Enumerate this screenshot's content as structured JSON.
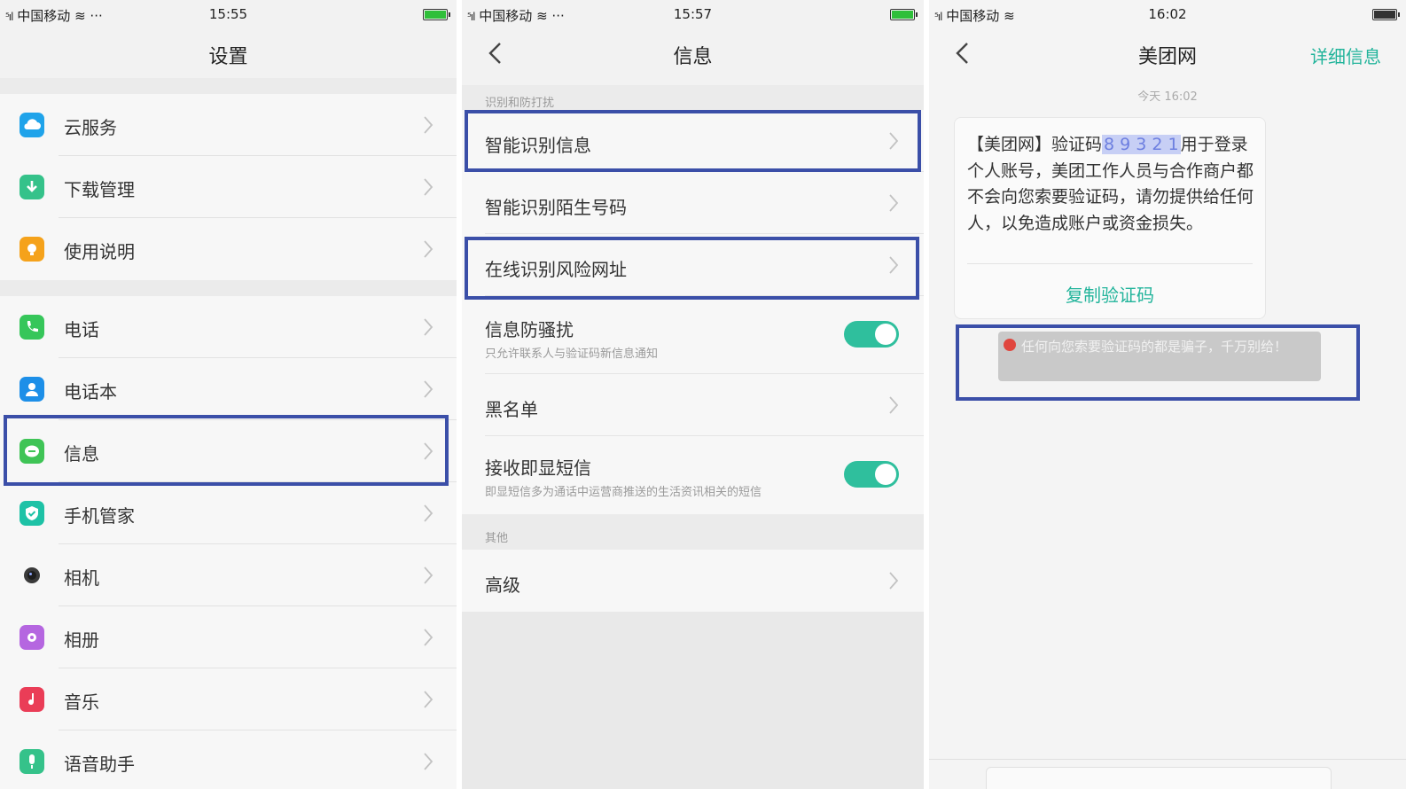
{
  "screens": [
    {
      "carrier": "中国移动",
      "status_extra": "···",
      "time": "15:55",
      "title": "设置",
      "groups": [
        [
          {
            "label": "云服务",
            "icon": "cloud-icon",
            "color": "#1fa3ea"
          },
          {
            "label": "下载管理",
            "icon": "download-icon",
            "color": "#35c28a"
          },
          {
            "label": "使用说明",
            "icon": "lightbulb-icon",
            "color": "#f5a21b"
          }
        ],
        [
          {
            "label": "电话",
            "icon": "phone-icon",
            "color": "#36c65a"
          },
          {
            "label": "电话本",
            "icon": "contacts-icon",
            "color": "#1d8fe8"
          },
          {
            "label": "信息",
            "icon": "message-icon",
            "color": "#3fc456",
            "highlighted": true
          },
          {
            "label": "手机管家",
            "icon": "shield-icon",
            "color": "#1ec2a6"
          },
          {
            "label": "相机",
            "icon": "camera-icon",
            "color": "#555555"
          },
          {
            "label": "相册",
            "icon": "gallery-icon",
            "color": "#b566e0"
          },
          {
            "label": "音乐",
            "icon": "music-icon",
            "color": "#ea3d57"
          },
          {
            "label": "语音助手",
            "icon": "microphone-icon",
            "color": "#35c28a"
          }
        ]
      ]
    },
    {
      "carrier": "中国移动",
      "status_extra": "···",
      "time": "15:57",
      "title": "信息",
      "section1": "识别和防打扰",
      "items": [
        {
          "label": "智能识别信息",
          "highlighted": true
        },
        {
          "label": "智能识别陌生号码"
        },
        {
          "label": "在线识别风险网址",
          "highlighted": true
        },
        {
          "label": "信息防骚扰",
          "sub": "只允许联系人与验证码新信息通知",
          "toggle": true
        },
        {
          "label": "黑名单"
        },
        {
          "label": "接收即显短信",
          "sub": "即显短信多为通话中运营商推送的生活资讯相关的短信",
          "toggle": true
        }
      ],
      "section2": "其他",
      "advanced": "高级"
    },
    {
      "carrier": "中国移动",
      "time": "16:02",
      "title": "美团网",
      "detail": "详细信息",
      "timestamp": "今天 16:02",
      "message_before": "【美团网】验证码",
      "message_code": "8 9 3 2 1",
      "message_after": "用于登录个人账号，美团工作人员与合作商户都不会向您索要验证码，请勿提供给任何人，以免造成账户或资金损失。",
      "copy_code": "复制验证码",
      "warning": "任何向您索要验证码的都是骗子，千万别给！"
    }
  ],
  "colors": {
    "accent": "#22b49b",
    "highlight": "#3b4fa8",
    "toggle_on": "#2fbf9d",
    "battery": "#2fbf3a"
  }
}
